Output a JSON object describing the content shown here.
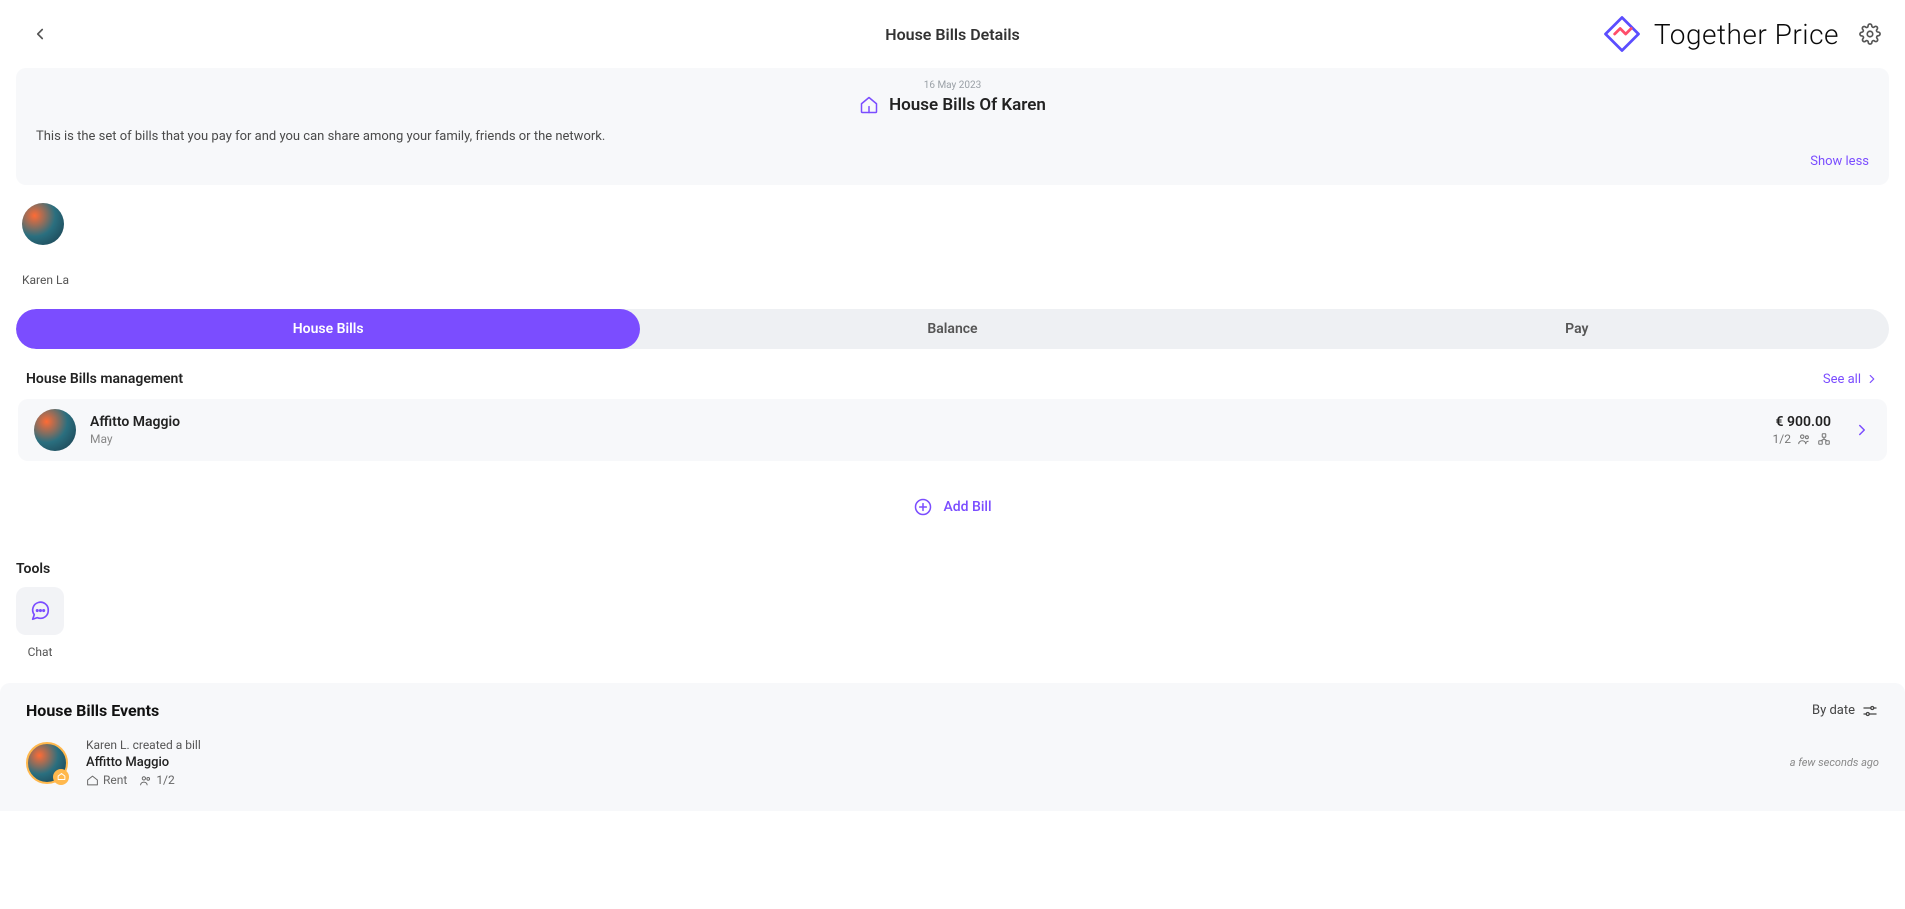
{
  "header": {
    "title": "House Bills Details",
    "brand": "Together Price"
  },
  "info": {
    "date": "16 May 2023",
    "title": "House Bills Of Karen",
    "description": "This is the set of bills that you pay for and you can share among your family, friends or the network.",
    "show_less": "Show less"
  },
  "owner": {
    "name": "Karen La"
  },
  "tabs": [
    {
      "label": "House Bills",
      "active": true
    },
    {
      "label": "Balance",
      "active": false
    },
    {
      "label": "Pay",
      "active": false
    }
  ],
  "management": {
    "title": "House Bills management",
    "see_all": "See all"
  },
  "bills": [
    {
      "title": "Affitto Maggio",
      "month": "May",
      "amount": "€ 900.00",
      "ratio": "1/2"
    }
  ],
  "add_bill": "Add Bill",
  "tools": {
    "title": "Tools",
    "items": [
      {
        "label": "Chat"
      }
    ]
  },
  "events": {
    "title": "House Bills Events",
    "sort_label": "By date",
    "items": [
      {
        "line1": "Karen L. created a bill",
        "line2": "Affitto Maggio",
        "category": "Rent",
        "ratio": "1/2",
        "time": "a few seconds ago"
      }
    ]
  },
  "colors": {
    "accent": "#7b4dff"
  }
}
